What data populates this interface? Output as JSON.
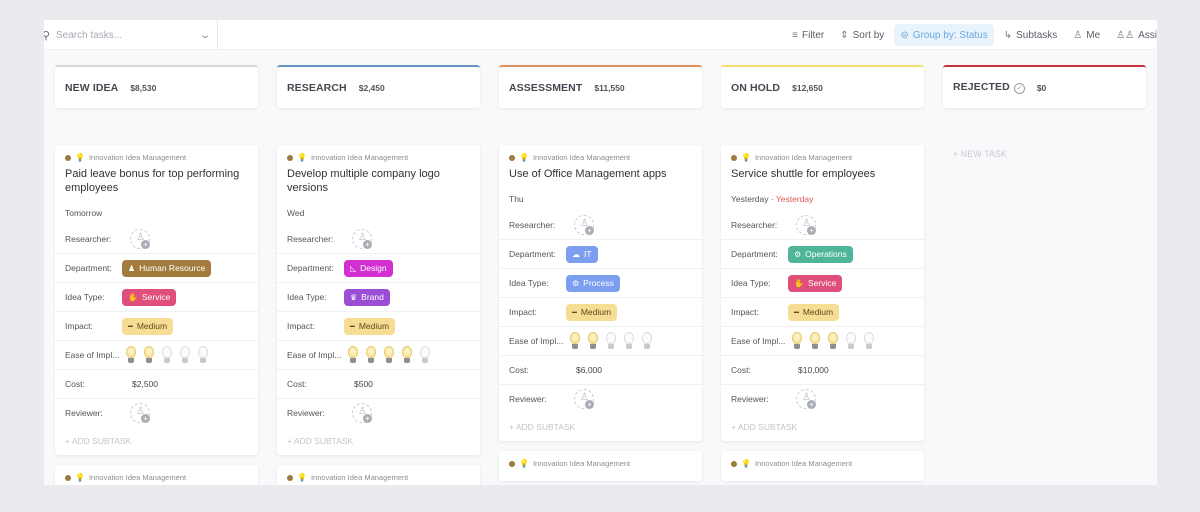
{
  "toolbar": {
    "search_placeholder": "Search tasks...",
    "filter_label": "Filter",
    "sort_label": "Sort by",
    "group_label": "Group by: Status",
    "subtasks_label": "Subtasks",
    "me_label": "Me",
    "assignees_label": "Assi"
  },
  "icons": {
    "search": "⚲",
    "chevron": "⌄",
    "filter": "≡",
    "sort": "⇕",
    "group": "⊜",
    "subtasks": "↳",
    "me": "♙",
    "assignees": "♙♙",
    "person": "♙",
    "plus": "+",
    "bulb": "💡",
    "check": "✓"
  },
  "labels": {
    "crumb": "Innovation Idea Management",
    "researcher": "Researcher:",
    "department": "Department:",
    "idea_type": "Idea Type:",
    "impact": "Impact:",
    "ease": "Ease of Impl...",
    "cost": "Cost:",
    "reviewer": "Reviewer:",
    "add_subtask": "+ ADD SUBTASK",
    "new_task": "+ NEW TASK"
  },
  "columns": [
    {
      "name": "NEW IDEA",
      "total": "$8,530",
      "color": "#d5d7db",
      "card": {
        "title": "Paid leave bonus for top performing employees",
        "date": "Tomorrow",
        "date_overdue": "",
        "department": {
          "label": "Human Resource",
          "icon": "♟",
          "color": "#a27c3d"
        },
        "idea_type": {
          "label": "Service",
          "icon": "✋",
          "color": "#e04f7b"
        },
        "impact": {
          "label": "Medium",
          "icon": "━",
          "color": "#f6dd93"
        },
        "ease_rating": 2,
        "ease_max": 5,
        "cost": "$2,500"
      }
    },
    {
      "name": "RESEARCH",
      "total": "$2,450",
      "color": "#6a92c2",
      "card": {
        "title": "Develop multiple company logo versions",
        "date": "Wed",
        "date_overdue": "",
        "department": {
          "label": "Design",
          "icon": "◺",
          "color": "#d12fd0"
        },
        "idea_type": {
          "label": "Brand",
          "icon": "♛",
          "color": "#9b4dd6"
        },
        "impact": {
          "label": "Medium",
          "icon": "━",
          "color": "#f6dd93"
        },
        "ease_rating": 4,
        "ease_max": 5,
        "cost": "$500"
      }
    },
    {
      "name": "ASSESSMENT",
      "total": "$11,550",
      "color": "#e0905a",
      "card": {
        "title": "Use of Office Management apps",
        "date": "Thu",
        "date_overdue": "",
        "department": {
          "label": "IT",
          "icon": "☁",
          "color": "#7b9ef0"
        },
        "idea_type": {
          "label": "Process",
          "icon": "⚙",
          "color": "#7b9ef0"
        },
        "impact": {
          "label": "Medium",
          "icon": "━",
          "color": "#f6dd93"
        },
        "ease_rating": 2,
        "ease_max": 5,
        "cost": "$6,000"
      }
    },
    {
      "name": "ON HOLD",
      "total": "$12,650",
      "color": "#f2e06c",
      "card": {
        "title": "Service shuttle for employees",
        "date": "Yesterday",
        "date_overdue": "Yesterday",
        "department": {
          "label": "Operations",
          "icon": "⚙",
          "color": "#4fb59a"
        },
        "idea_type": {
          "label": "Service",
          "icon": "✋",
          "color": "#e04f7b"
        },
        "impact": {
          "label": "Medium",
          "icon": "━",
          "color": "#f6dd93"
        },
        "ease_rating": 3,
        "ease_max": 5,
        "cost": "$10,000"
      }
    },
    {
      "name": "REJECTED",
      "total": "$0",
      "color": "#c8323a"
    }
  ]
}
